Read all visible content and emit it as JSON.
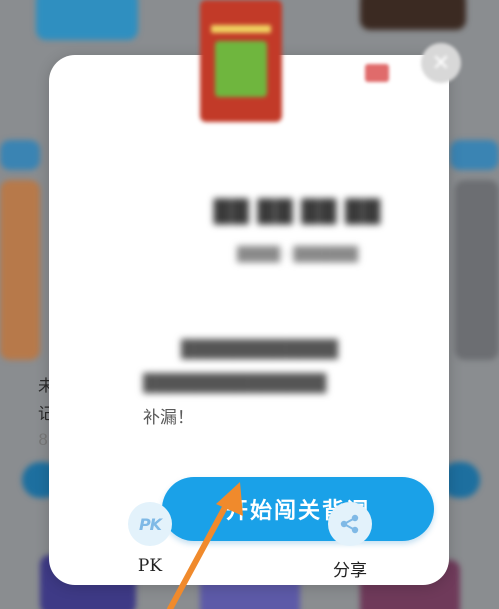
{
  "background": {
    "partial_text_1": "未",
    "partial_text_2": "记",
    "partial_text_3": "8"
  },
  "modal": {
    "description_visible_end": "补漏！",
    "start_button_label": "开始闯关背词",
    "actions": [
      {
        "icon": "pk-icon",
        "glyph": "PK",
        "label": "PK"
      },
      {
        "icon": "share-icon",
        "label": "分享"
      }
    ],
    "close_icon": "close-icon"
  },
  "colors": {
    "accent": "#1aa1e8",
    "arrow": "#f08a2c",
    "action_circle": "#e3f2fb"
  }
}
